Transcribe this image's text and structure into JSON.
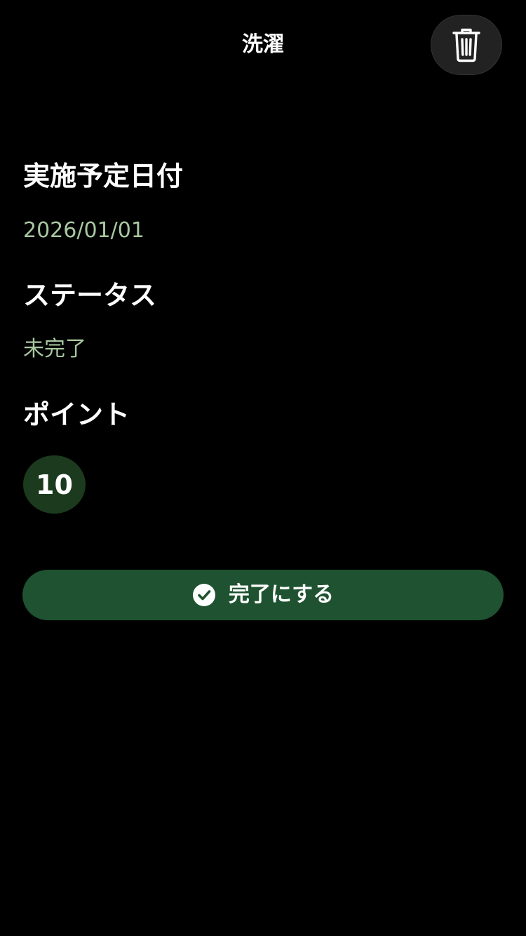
{
  "nav": {
    "title": "洗濯",
    "delete_icon": "trash-icon"
  },
  "scheduled_date": {
    "heading": "実施予定日付",
    "value": "2026/01/01"
  },
  "status": {
    "heading": "ステータス",
    "value": "未完了"
  },
  "points": {
    "heading": "ポイント",
    "value": "10"
  },
  "complete_button": {
    "label": "完了にする",
    "icon": "check-circle-icon"
  },
  "colors": {
    "background": "#000000",
    "value_text": "#a8c8a0",
    "badge_bg": "#1c3a1e",
    "button_bg": "#1e5230",
    "trash_button_bg": "#222222"
  }
}
